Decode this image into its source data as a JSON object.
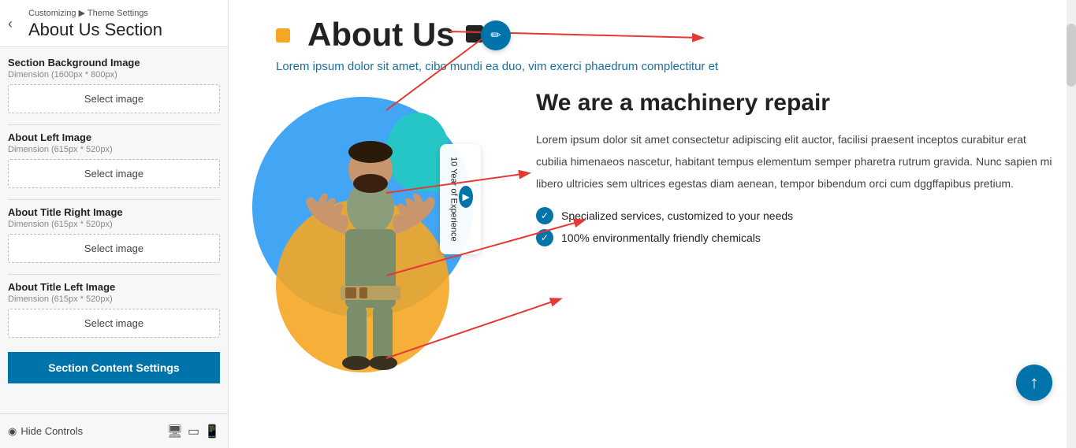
{
  "panel": {
    "back_label": "‹",
    "breadcrumb": "Customizing ▶ Theme Settings",
    "section_title": "About Us Section",
    "fields": [
      {
        "id": "section-background",
        "label": "Section Background Image",
        "dimension": "Dimension (1600px * 800px)",
        "button_label": "Select image"
      },
      {
        "id": "about-left",
        "label": "About Left Image",
        "dimension": "Dimension (615px * 520px)",
        "button_label": "Select image"
      },
      {
        "id": "about-title-right",
        "label": "About Title Right Image",
        "dimension": "Dimension (615px * 520px)",
        "button_label": "Select image"
      },
      {
        "id": "about-title-left",
        "label": "About Title Left Image",
        "dimension": "Dimension (615px * 520px)",
        "button_label": "Select image"
      }
    ],
    "section_content_btn": "Section Content Settings"
  },
  "bottom_bar": {
    "hide_controls_label": "Hide Controls",
    "icons": [
      "desktop",
      "tablet",
      "mobile"
    ]
  },
  "preview": {
    "edit_icon": "✏",
    "title_icon_left": "▲",
    "title": "About Us",
    "title_icon_right": "◣",
    "subtitle": "Lorem ipsum dolor sit amet, cibo mundi ea duo, vim exerci phaedrum complectitur et",
    "heading": "We are a machinery repair",
    "description": "Lorem ipsum dolor sit amet consectetur adipiscing elit auctor, facilisi praesent inceptos curabitur erat cubilia himenaeos nascetur, habitant tempus elementum semper pharetra rutrum gravida. Nunc sapien mi libero ultricies sem ultrices egestas diam aenean, tempor bibendum orci cum dggffapibus pretium.",
    "experience_card": {
      "icon": "▶",
      "text": "10 Year of Experience"
    },
    "features": [
      "Specialized services, customized to your needs",
      "100% environmentally friendly chemicals"
    ],
    "up_button": "↑"
  }
}
